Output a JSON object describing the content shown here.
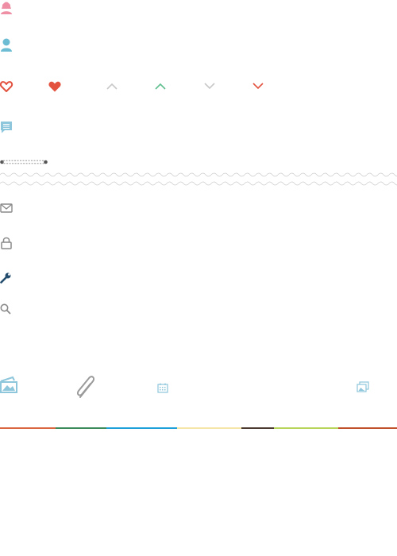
{
  "icons": {
    "user_female": "user-female-icon",
    "user_male": "user-male-icon",
    "heart_outline": "heart-outline-icon",
    "heart_filled": "heart-filled-icon",
    "chevron_up_gray": "chevron-up-icon",
    "chevron_up_green": "chevron-up-icon",
    "chevron_down_gray": "chevron-down-icon",
    "chevron_down_red": "chevron-down-icon",
    "comment": "comment-icon",
    "zipper": "zipper-icon",
    "mail": "mail-icon",
    "lock": "lock-icon",
    "wrench": "wrench-icon",
    "search": "search-icon",
    "photo": "photo-icon",
    "paperclip": "paperclip-icon",
    "calendar": "calendar-icon",
    "gallery": "gallery-icon"
  },
  "colors": {
    "pink": "#ee8fa6",
    "teal": "#6cbcd4",
    "red": "#e2523f",
    "gray_light": "#c8c8c8",
    "green": "#5fbf8f",
    "blue_light": "#8ec6dc",
    "navy": "#244d6e",
    "gray_dark": "#8a8a8a",
    "stripe_1": "#d9663f",
    "stripe_2": "#3a8a5a",
    "stripe_3": "#1d9fd9",
    "stripe_4": "#f5e6a8",
    "stripe_5": "#4a3a30",
    "stripe_6": "#b8d45a",
    "stripe_7": "#c0502a"
  }
}
